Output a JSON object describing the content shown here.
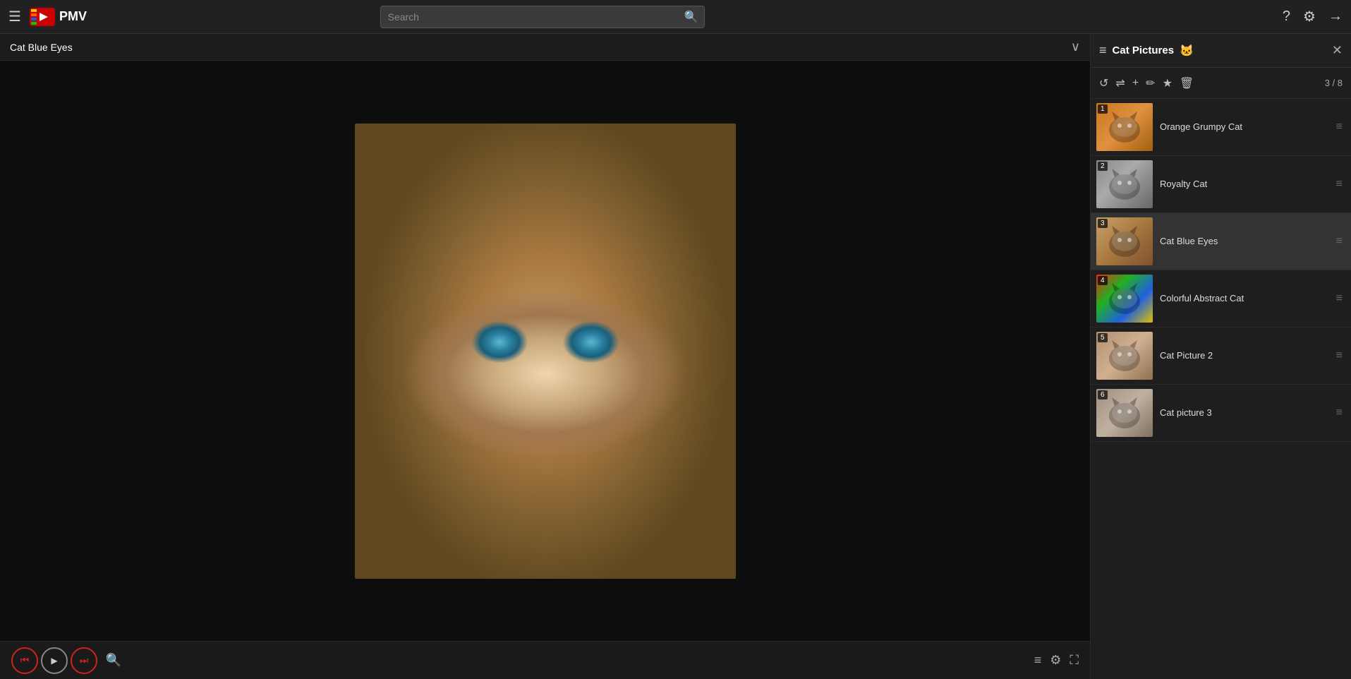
{
  "topbar": {
    "menu_label": "☰",
    "logo_text": "PMV",
    "search_placeholder": "Search",
    "search_btn_icon": "🔍",
    "help_icon": "?",
    "settings_icon": "⚙",
    "logout_icon": "→"
  },
  "viewer": {
    "title": "Cat Blue Eyes",
    "expand_icon": "∨"
  },
  "controls": {
    "prev_icon": "⏮",
    "play_icon": "▶",
    "next_icon": "⏭",
    "search_icon": "🔍",
    "list_icon": "≡",
    "settings_icon": "⚙",
    "fullscreen_icon": "⛶"
  },
  "panel": {
    "list_icon": "≡",
    "title": "Cat Pictures",
    "emoji": "🐱",
    "close_icon": "✕",
    "count": "3 / 8",
    "toolbar": {
      "refresh_icon": "↺",
      "shuffle_icon": "⇌",
      "add_icon": "+",
      "edit_icon": "✏",
      "favorite_icon": "★",
      "delete_icon": "🗑"
    }
  },
  "playlist": {
    "items": [
      {
        "number": "1",
        "title": "Orange Grumpy Cat",
        "active": false,
        "thumb_class": "thumb-orange"
      },
      {
        "number": "2",
        "title": "Royalty Cat",
        "active": false,
        "thumb_class": "thumb-royalty"
      },
      {
        "number": "3",
        "title": "Cat Blue Eyes",
        "active": true,
        "thumb_class": "thumb-blue-eyes"
      },
      {
        "number": "4",
        "title": "Colorful Abstract Cat",
        "active": false,
        "thumb_class": "thumb-colorful"
      },
      {
        "number": "5",
        "title": "Cat Picture 2",
        "active": false,
        "thumb_class": "thumb-cat2"
      },
      {
        "number": "6",
        "title": "Cat picture 3",
        "active": false,
        "thumb_class": "thumb-cat3"
      }
    ]
  }
}
